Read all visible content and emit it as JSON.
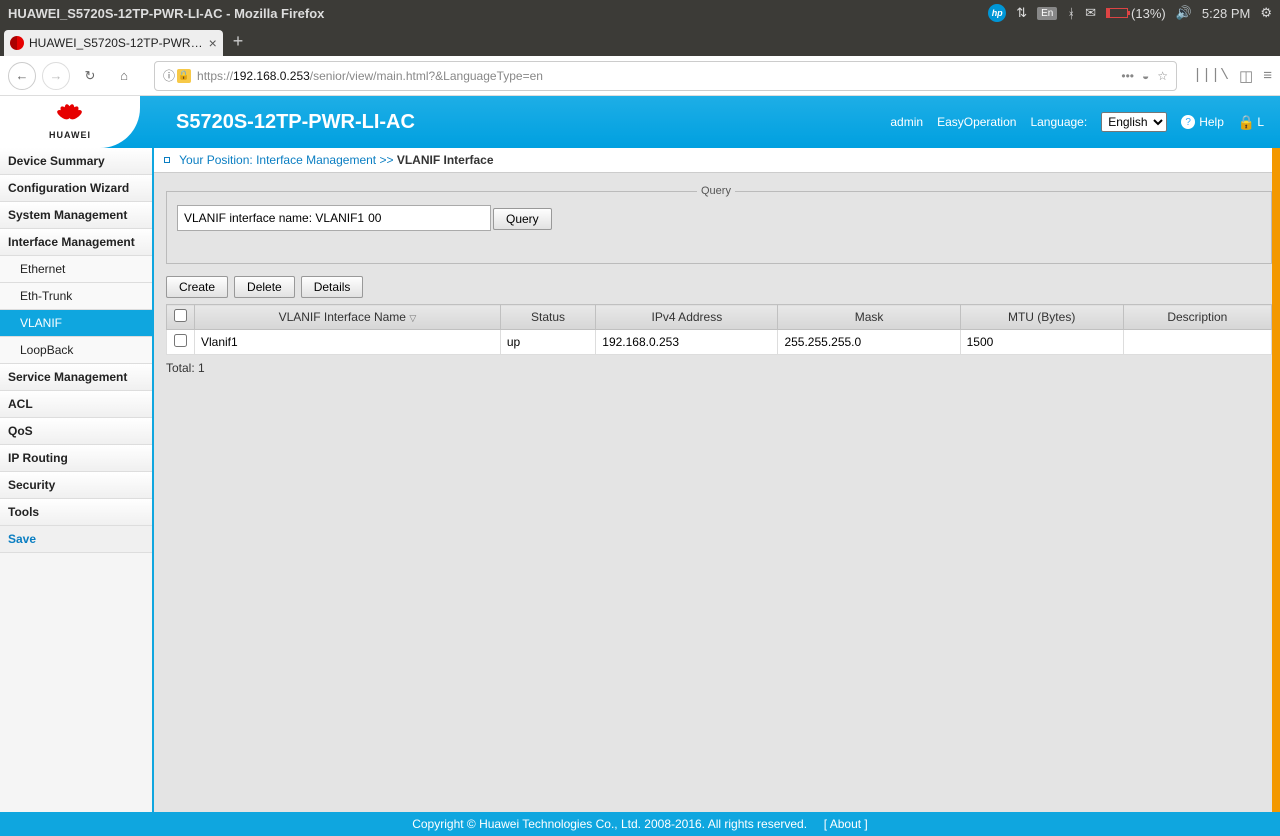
{
  "os": {
    "window_title": "HUAWEI_S5720S-12TP-PWR-LI-AC - Mozilla Firefox",
    "lang_indicator": "En",
    "battery_pct": "(13%)",
    "time": "5:28 PM"
  },
  "browser": {
    "tab_title": "HUAWEI_S5720S-12TP-PWR…",
    "url_proto": "https://",
    "url_host": "192.168.0.253",
    "url_path": "/senior/view/main.html?&LanguageType=en"
  },
  "header": {
    "brand": "HUAWEI",
    "device": "S5720S-12TP-PWR-LI-AC",
    "user": "admin",
    "easy": "EasyOperation",
    "language_label": "Language:",
    "language_value": "English",
    "help": "Help",
    "logout": "L"
  },
  "sidebar": {
    "items": [
      {
        "label": "Device Summary",
        "sub": false
      },
      {
        "label": "Configuration Wizard",
        "sub": false
      },
      {
        "label": "System Management",
        "sub": false
      },
      {
        "label": "Interface Management",
        "sub": false
      },
      {
        "label": "Ethernet",
        "sub": true
      },
      {
        "label": "Eth-Trunk",
        "sub": true
      },
      {
        "label": "VLANIF",
        "sub": true,
        "active": true
      },
      {
        "label": "LoopBack",
        "sub": true
      },
      {
        "label": "Service Management",
        "sub": false
      },
      {
        "label": "ACL",
        "sub": false
      },
      {
        "label": "QoS",
        "sub": false
      },
      {
        "label": "IP Routing",
        "sub": false
      },
      {
        "label": "Security",
        "sub": false
      },
      {
        "label": "Tools",
        "sub": false
      }
    ],
    "save": "Save"
  },
  "breadcrumb": {
    "prefix": "Your Position: Interface Management >>",
    "current": "VLANIF Interface"
  },
  "query": {
    "legend": "Query",
    "label": "VLANIF interface name: VLANIF1",
    "value": "00",
    "button": "Query"
  },
  "actions": {
    "create": "Create",
    "delete": "Delete",
    "details": "Details"
  },
  "table": {
    "headers": {
      "name": "VLANIF Interface Name",
      "status": "Status",
      "ipv4": "IPv4 Address",
      "mask": "Mask",
      "mtu": "MTU (Bytes)",
      "desc": "Description"
    },
    "rows": [
      {
        "name": "Vlanif1",
        "status": "up",
        "ipv4": "192.168.0.253",
        "mask": "255.255.255.0",
        "mtu": "1500",
        "desc": ""
      }
    ],
    "total": "Total: 1"
  },
  "footer": {
    "copyright": "Copyright © Huawei Technologies Co., Ltd. 2008-2016. All rights reserved.",
    "about": "[ About ]"
  }
}
